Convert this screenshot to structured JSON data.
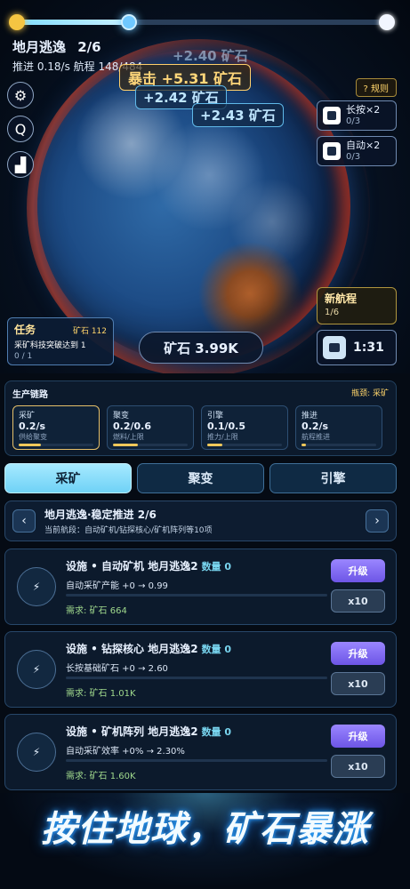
{
  "header": {
    "stage": "地月逃逸",
    "stage_progress": "2/6",
    "stats": "推进 0.18/s  航程 148/484",
    "voyage_progress": 0.31
  },
  "side_buttons": [
    {
      "icon": "gear-icon",
      "glyph": "⚙"
    },
    {
      "icon": "search-icon",
      "glyph": "Q"
    },
    {
      "icon": "leaderboard-icon",
      "glyph": "▟"
    }
  ],
  "floating": {
    "crit": "暴击 +5.31 矿石",
    "popup_a": "+2.40 矿石",
    "popup_b": "+2.42 矿石",
    "popup_c": "+2.43 矿石"
  },
  "rules_label": "? 规则",
  "boosts": [
    {
      "label": "长按×2",
      "count": "0/3"
    },
    {
      "label": "自动×2",
      "count": "0/3"
    }
  ],
  "new_voyage": {
    "title": "新航程",
    "progress": "1/6"
  },
  "timer": "1:31",
  "task": {
    "title": "任务",
    "reward": "矿石 112",
    "desc": "采矿科技突破达到 1",
    "progress": "0 / 1"
  },
  "ore_total": "矿石 3.99K",
  "chain": {
    "title": "生产链路",
    "bottleneck": "瓶颈: 采矿",
    "items": [
      {
        "name": "采矿",
        "value": "0.2/s",
        "note": "供给聚变",
        "fill": 0.3,
        "active": true
      },
      {
        "name": "聚变",
        "value": "0.2/0.6",
        "note": "燃料/上限",
        "fill": 0.33,
        "active": false
      },
      {
        "name": "引擎",
        "value": "0.1/0.5",
        "note": "推力/上限",
        "fill": 0.2,
        "active": false
      },
      {
        "name": "推进",
        "value": "0.2/s",
        "note": "航程推进",
        "fill": 0.06,
        "active": false
      }
    ]
  },
  "tabs": [
    "采矿",
    "聚变",
    "引擎"
  ],
  "stage_nav": {
    "prev": "‹",
    "next": "›",
    "title": "地月逃逸·稳定推进 2/6",
    "subtitle": "当前航段：自动矿机/钻探核心/矿机阵列等10项"
  },
  "facilities": [
    {
      "title": "设施 • 自动矿机 地月逃逸2",
      "count": "数量 0",
      "desc": "自动采矿产能 +0 → 0.99",
      "req": "需求: 矿石 664",
      "upgrade": "升级",
      "x10": "x10"
    },
    {
      "title": "设施 • 钻探核心 地月逃逸2",
      "count": "数量 0",
      "desc": "长按基础矿石 +0 → 2.60",
      "req": "需求: 矿石 1.01K",
      "upgrade": "升级",
      "x10": "x10"
    },
    {
      "title": "设施 • 矿机阵列 地月逃逸2",
      "count": "数量 0",
      "desc": "自动采矿效率 +0% → 2.30%",
      "req": "需求: 矿石 1.60K",
      "upgrade": "升级",
      "x10": "x10"
    }
  ],
  "banner": "按住地球，矿石暴涨",
  "colors": {
    "accent": "#6fd2f6",
    "upgrade": "#7f66f0",
    "gold": "#ffd56b"
  }
}
